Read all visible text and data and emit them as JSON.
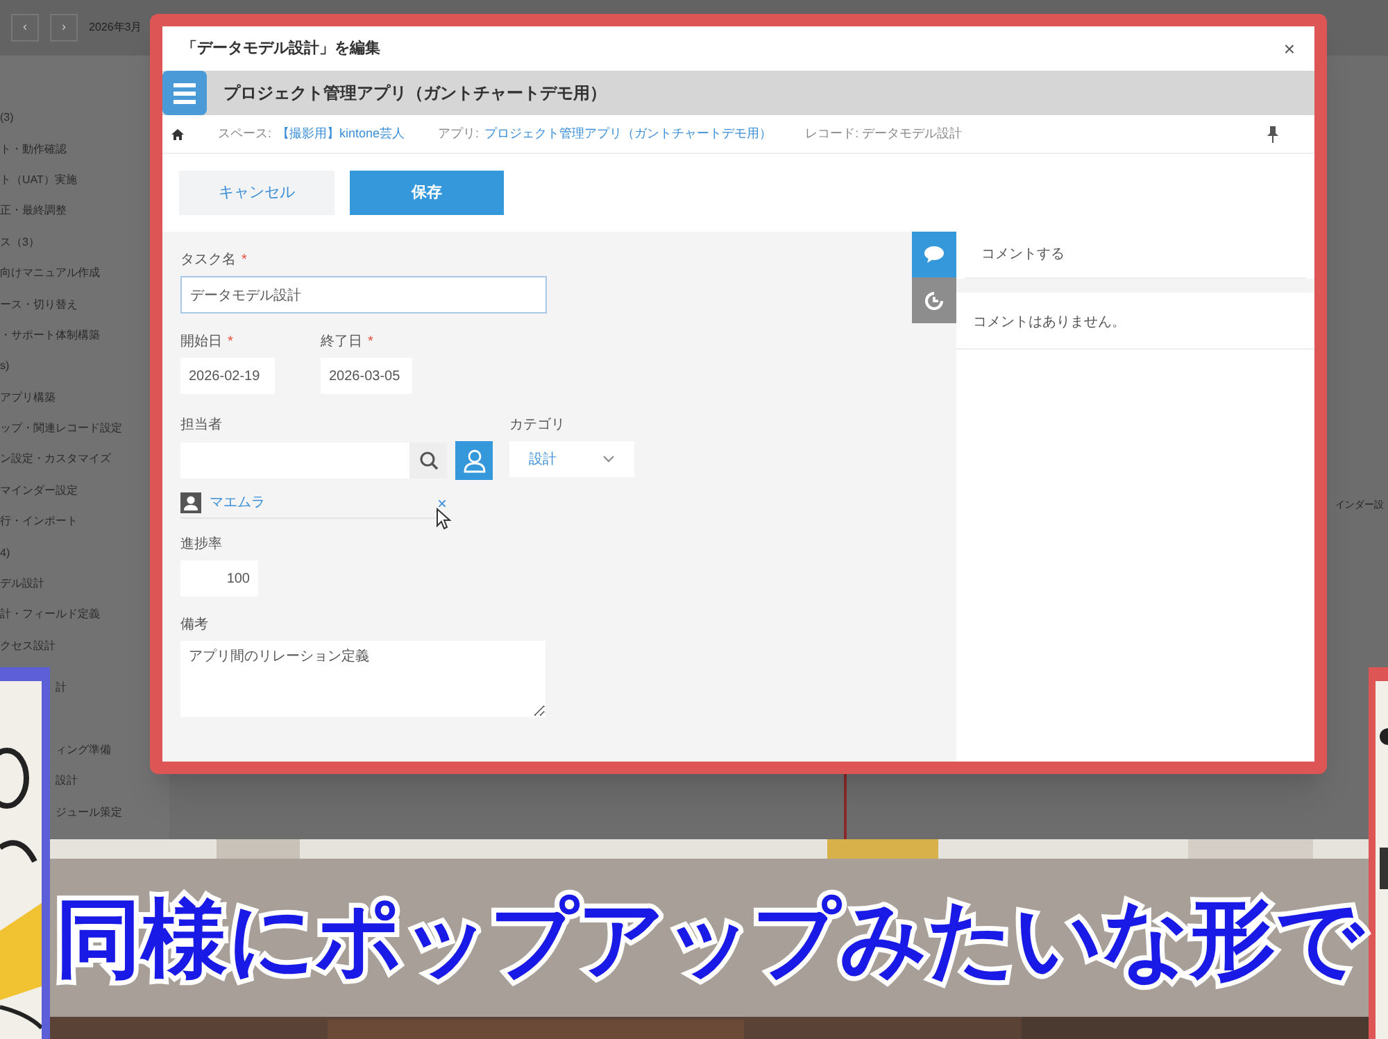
{
  "background_app": {
    "nav_buttons": [
      "‹",
      "›"
    ],
    "month": "2026年3月",
    "list_items": [
      "(3)",
      "ト・動作確認",
      "ト（UAT）実施",
      "正・最終調整",
      "ス（3）",
      "向けマニュアル作成",
      "ース・切り替え",
      "・サポート体制構築",
      "s)",
      "アプリ構築",
      "ップ・関連レコード設定",
      "ン設定・カスタマイズ",
      "マインダー設定",
      "行・インポート",
      "4)",
      "デル設計",
      "計・フィールド定義",
      "クセス設計"
    ],
    "items_beside_picture": [
      "計",
      "ィング準備",
      "設計",
      "ジュール策定"
    ],
    "right_label": "インダー設"
  },
  "dialog": {
    "title": "「データモデル設計」を編集",
    "close": "×",
    "app_title": "プロジェクト管理アプリ（ガントチャートデモ用）",
    "breadcrumb": [
      {
        "label": "スペース:",
        "link": "【撮影用】kintone芸人"
      },
      {
        "label": "アプリ:",
        "link": "プロジェクト管理アプリ（ガントチャートデモ用）"
      },
      {
        "label": "レコード: データモデル設計"
      }
    ],
    "buttons": [
      {
        "kind": "cancel",
        "label": "キャンセル"
      },
      {
        "kind": "save",
        "label": "保存"
      }
    ],
    "task_name": {
      "label": "タスク名",
      "mark": "*",
      "value": "データモデル設計"
    },
    "start_date": {
      "label": "開始日",
      "mark": "*",
      "value": "2026-02-19"
    },
    "end_date": {
      "label": "終了日",
      "mark": "*",
      "value": "2026-03-05"
    },
    "assignee": {
      "label": "担当者",
      "users": [
        {
          "name": "マエムラ",
          "remove": "×"
        }
      ]
    },
    "category": {
      "label": "カテゴリ",
      "value": "設計"
    },
    "progress": {
      "label": "進捗率",
      "value": "100"
    },
    "notes": {
      "label": "備考",
      "value": "アプリ間のリレーション定義"
    },
    "side_tabs": [
      {
        "kind": "comment",
        "selected": true
      },
      {
        "kind": "history",
        "selected": false
      }
    ],
    "comments": {
      "placeholder": "コメントする",
      "empty": "コメントはありません。"
    }
  },
  "caption": "同様にポップアップみたいな形で"
}
